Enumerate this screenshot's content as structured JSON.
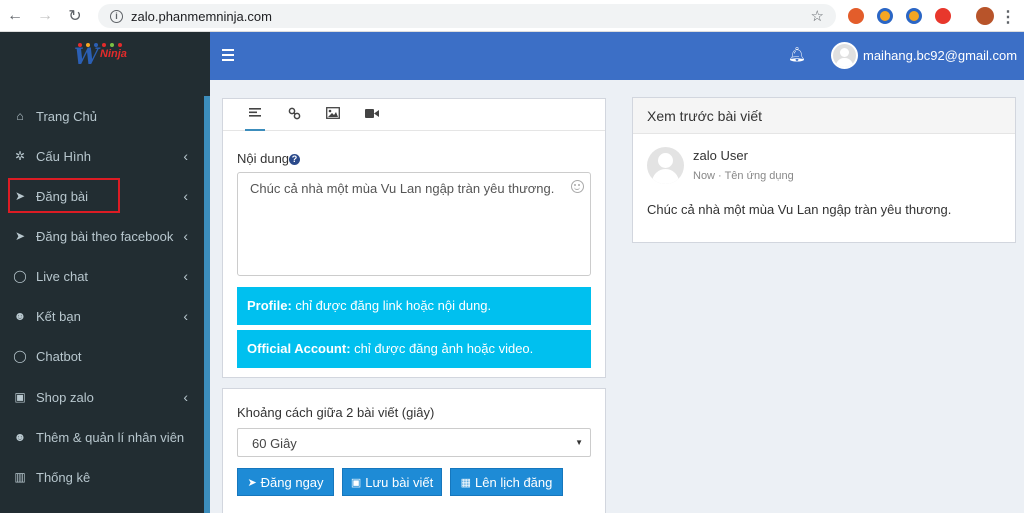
{
  "browser": {
    "url": "zalo.phanmemninja.com"
  },
  "brand": {
    "logo_letter": "W",
    "logo_text": "Ninja"
  },
  "sidebar": {
    "items": [
      {
        "label": "Trang Chủ",
        "icon": "home-icon",
        "glyph": "⌂",
        "has_chevron": false
      },
      {
        "label": "Cấu Hình",
        "icon": "gear-icon",
        "glyph": "✲",
        "has_chevron": true
      },
      {
        "label": "Đăng bài",
        "icon": "paper-plane-icon",
        "glyph": "➤",
        "has_chevron": true
      },
      {
        "label": "Đăng bài theo facebook",
        "icon": "paper-plane-icon",
        "glyph": "➤",
        "has_chevron": true
      },
      {
        "label": "Live chat",
        "icon": "chat-bubble-icon",
        "glyph": "◯",
        "has_chevron": true
      },
      {
        "label": "Kết bạn",
        "icon": "users-icon",
        "glyph": "☻",
        "has_chevron": true
      },
      {
        "label": "Chatbot",
        "icon": "chat-bubble-icon",
        "glyph": "◯",
        "has_chevron": false
      },
      {
        "label": "Shop zalo",
        "icon": "shopping-bag-icon",
        "glyph": "▣",
        "has_chevron": true
      },
      {
        "label": "Thêm & quản lí nhân viên",
        "icon": "user-plus-icon",
        "glyph": "☻",
        "has_chevron": false
      },
      {
        "label": "Thống kê",
        "icon": "bar-chart-icon",
        "glyph": "▥",
        "has_chevron": false
      }
    ]
  },
  "header": {
    "user_email": "maihang.bc92@gmail.com"
  },
  "editor": {
    "content_label": "Nội dung",
    "content_value": "Chúc cả nhà một mùa Vu Lan ngập tràn yêu thương.",
    "notice_profile_bold": "Profile:",
    "notice_profile_text": " chỉ được đăng link hoặc nội dung.",
    "notice_official_bold": "Official Account:",
    "notice_official_text": " chỉ được đăng ảnh hoặc video."
  },
  "options": {
    "interval_label": "Khoảng cách giữa 2 bài viết (giây)",
    "interval_selected": "60 Giây",
    "post_now": "Đăng ngay",
    "save_post": "Lưu bài viết",
    "schedule_post": "Lên lịch đăng"
  },
  "preview": {
    "title": "Xem trước bài viết",
    "user_name": "zalo User",
    "meta": "Now · Tên ứng dụng",
    "content": "Chúc cả nhà một mùa Vu Lan ngập tràn yêu thương."
  },
  "colors": {
    "header": "#3c6fc6",
    "sidebar": "#222d32",
    "info_box": "#00c0ef",
    "button": "#1e8bd6",
    "highlight_border": "#dd1c24"
  }
}
